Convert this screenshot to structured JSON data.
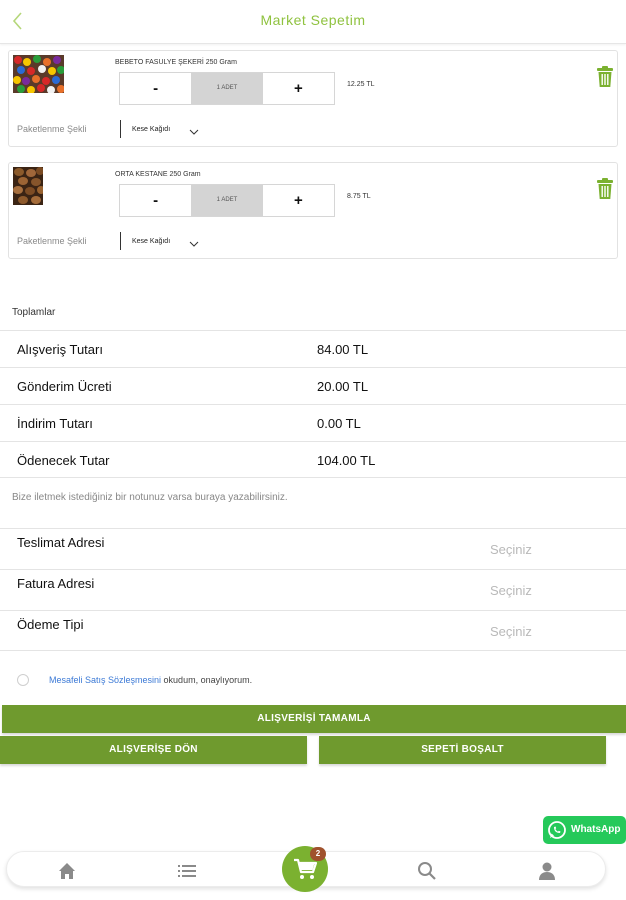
{
  "header": {
    "title": "Market Sepetim"
  },
  "cart_items": [
    {
      "name": "BEBETO FASULYE ŞEKERİ 250 Gram",
      "qty": "1 ADET",
      "minus": "-",
      "plus": "+",
      "price": "12.25 TL",
      "pack_label": "Paketlenme Şekli",
      "pack_value": "Kese Kağıdı"
    },
    {
      "name": "ORTA KESTANE 250 Gram",
      "qty": "1 ADET",
      "minus": "-",
      "plus": "+",
      "price": "8.75 TL",
      "pack_label": "Paketlenme Şekli",
      "pack_value": "Kese Kağıdı"
    }
  ],
  "totals": {
    "heading": "Toplamlar",
    "rows": [
      {
        "label": "Alışveriş Tutarı",
        "value": "84.00 TL"
      },
      {
        "label": "Gönderim Ücreti",
        "value": "20.00 TL"
      },
      {
        "label": "İndirim Tutarı",
        "value": "0.00 TL"
      },
      {
        "label": "Ödenecek Tutar",
        "value": "104.00 TL"
      }
    ]
  },
  "note_placeholder": "Bize iletmek istediğiniz bir notunuz varsa buraya yazabilirsiniz.",
  "selects": [
    {
      "label": "Teslimat Adresi",
      "value": "Seçiniz"
    },
    {
      "label": "Fatura Adresi",
      "value": "Seçiniz"
    },
    {
      "label": "Ödeme Tipi",
      "value": "Seçiniz"
    }
  ],
  "agreement": {
    "link": "Mesafeli Satış Sözleşmesini",
    "text": " okudum, onaylıyorum."
  },
  "buttons": {
    "complete": "ALIŞVERİŞİ TAMAMLA",
    "back_to_shop": "ALIŞVERİŞE DÖN",
    "empty_cart": "SEPETİ BOŞALT"
  },
  "whatsapp": {
    "label": "WhatsApp"
  },
  "tabbar": {
    "cart_badge": "2",
    "icons": [
      "home-icon",
      "list-icon",
      "cart-icon",
      "search-icon",
      "user-icon"
    ]
  },
  "colors": {
    "accent": "#8fc23f",
    "button": "#6f9a2e",
    "whatsapp": "#25c95a",
    "badge": "#a0522d",
    "link": "#3c7ad6"
  }
}
